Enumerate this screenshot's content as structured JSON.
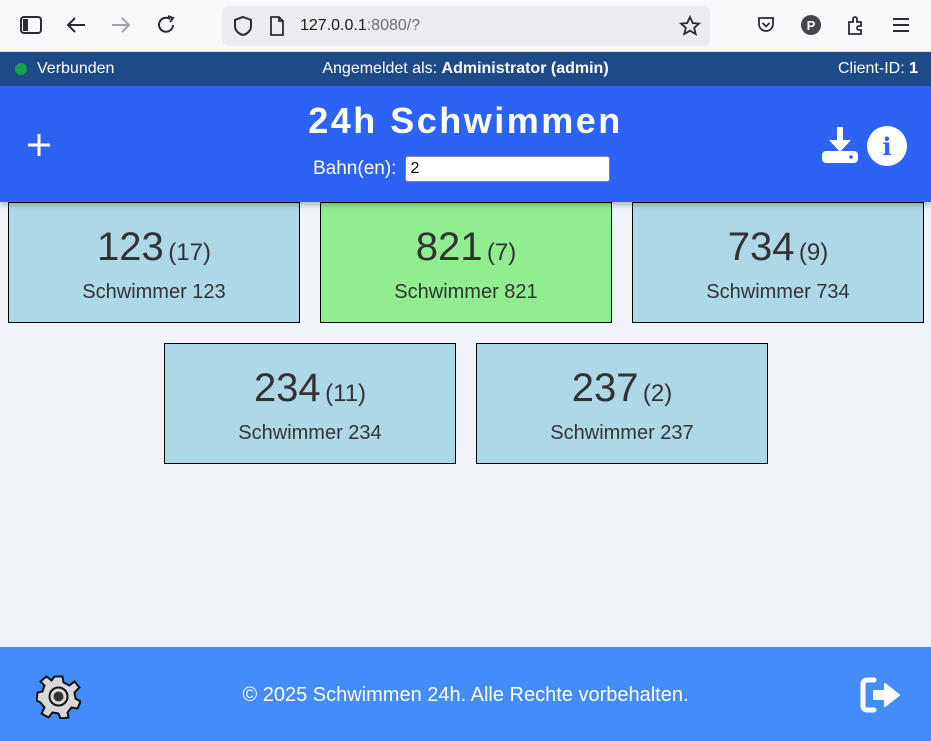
{
  "browser": {
    "url_host": "127.0.0.1",
    "url_rest": ":8080/?"
  },
  "status": {
    "connection": "Verbunden",
    "logged_in_label": "Angemeldet als:",
    "user": "Administrator (admin)",
    "client_label": "Client-ID:",
    "client_id": "1"
  },
  "header": {
    "title": "24h Schwimmen",
    "lanes_label": "Bahn(en):",
    "lanes_value": "2"
  },
  "swimmers": [
    {
      "number": "123",
      "count": "(17)",
      "name": "Schwimmer 123",
      "active": false
    },
    {
      "number": "821",
      "count": "(7)",
      "name": "Schwimmer 821",
      "active": true
    },
    {
      "number": "734",
      "count": "(9)",
      "name": "Schwimmer 734",
      "active": false
    },
    {
      "number": "234",
      "count": "(11)",
      "name": "Schwimmer 234",
      "active": false
    },
    {
      "number": "237",
      "count": "(2)",
      "name": "Schwimmer 237",
      "active": false
    }
  ],
  "footer": {
    "copyright": "© 2025 Schwimmen 24h. Alle Rechte vorbehalten."
  },
  "icons": {
    "add": "plus-icon",
    "download": "download-icon",
    "info": "info-icon",
    "settings": "gear-icon",
    "logout": "logout-icon"
  },
  "colors": {
    "status_bar": "#1f4a8a",
    "header": "#2d63f5",
    "footer": "#448cf9",
    "card_default": "#add8e6",
    "card_active": "#90ee90",
    "connected_dot": "#16a34a"
  }
}
